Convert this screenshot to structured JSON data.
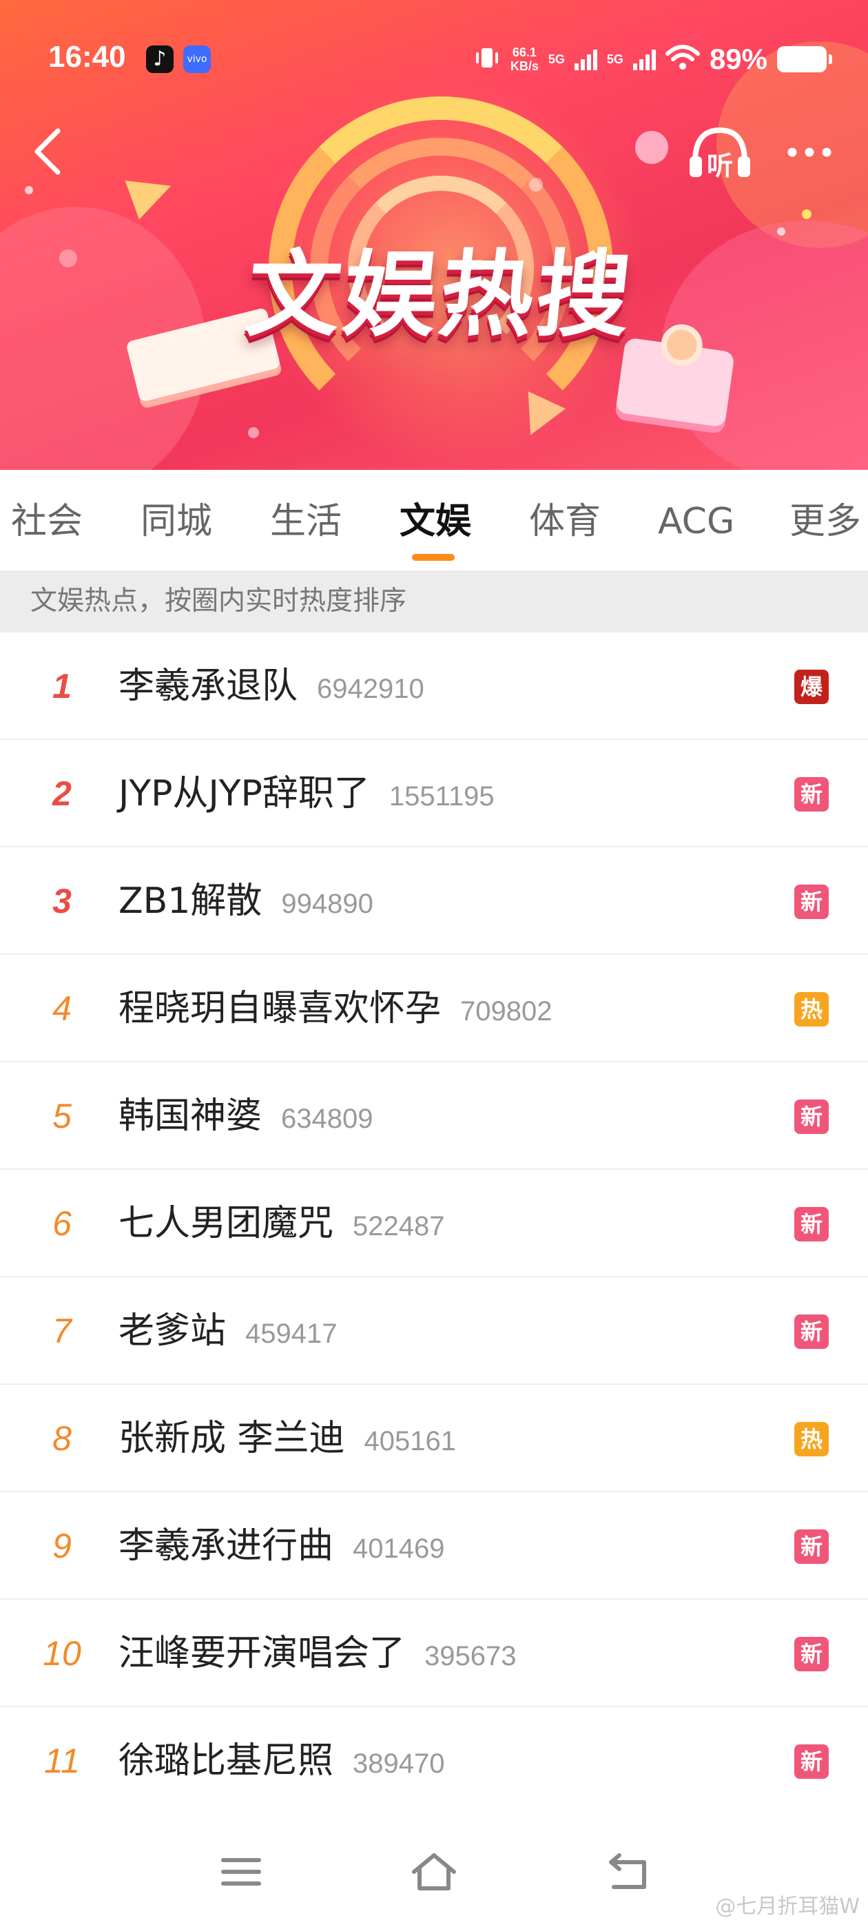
{
  "status_bar": {
    "time": "16:40",
    "speed_value": "66.1",
    "speed_unit": "KB/s",
    "net1": "5G",
    "net2": "5G",
    "battery_pct": "89%"
  },
  "banner": {
    "title": "文娱热搜",
    "listen_label": "听"
  },
  "tabs": [
    {
      "label": "社会"
    },
    {
      "label": "同城"
    },
    {
      "label": "生活"
    },
    {
      "label": "文娱",
      "active": true
    },
    {
      "label": "体育"
    },
    {
      "label": "ACG"
    },
    {
      "label": "更多"
    }
  ],
  "subheader": "文娱热点，按圈内实时热度排序",
  "items": [
    {
      "rank": "1",
      "title": "李羲承退队",
      "count": "6942910",
      "badge": "爆",
      "badge_color": "#c3221c"
    },
    {
      "rank": "2",
      "title": "JYP从JYP辞职了",
      "count": "1551195",
      "badge": "新",
      "badge_color": "#f0567a"
    },
    {
      "rank": "3",
      "title": "ZB1解散",
      "count": "994890",
      "badge": "新",
      "badge_color": "#f0567a"
    },
    {
      "rank": "4",
      "title": "程晓玥自曝喜欢怀孕",
      "count": "709802",
      "badge": "热",
      "badge_color": "#f7a520"
    },
    {
      "rank": "5",
      "title": "韩国神婆",
      "count": "634809",
      "badge": "新",
      "badge_color": "#f0567a"
    },
    {
      "rank": "6",
      "title": "七人男团魔咒",
      "count": "522487",
      "badge": "新",
      "badge_color": "#f0567a"
    },
    {
      "rank": "7",
      "title": "老爹站",
      "count": "459417",
      "badge": "新",
      "badge_color": "#f0567a"
    },
    {
      "rank": "8",
      "title": "张新成 李兰迪",
      "count": "405161",
      "badge": "热",
      "badge_color": "#f7a520"
    },
    {
      "rank": "9",
      "title": "李羲承进行曲",
      "count": "401469",
      "badge": "新",
      "badge_color": "#f0567a"
    },
    {
      "rank": "10",
      "title": "汪峰要开演唱会了",
      "count": "395673",
      "badge": "新",
      "badge_color": "#f0567a"
    },
    {
      "rank": "11",
      "title": "徐璐比基尼照",
      "count": "389470",
      "badge": "新",
      "badge_color": "#f0567a"
    }
  ],
  "watermark": "@七月折耳猫W",
  "icons": {
    "back": "chevron-left-icon",
    "listen": "headphones-icon",
    "more": "more-dots-icon",
    "menu": "menu-icon",
    "home": "home-icon",
    "return": "return-icon"
  }
}
